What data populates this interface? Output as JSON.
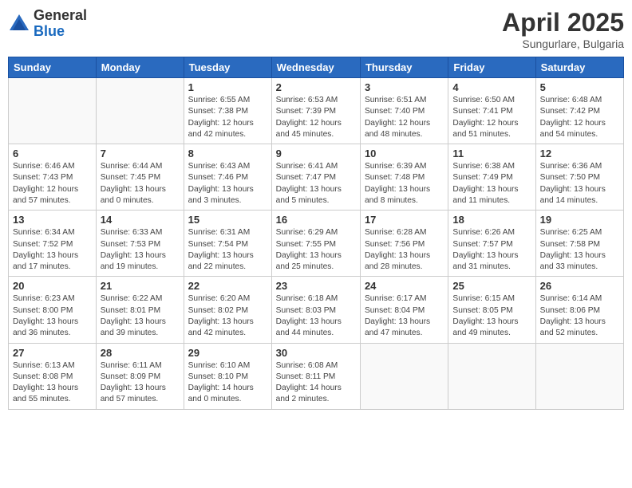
{
  "header": {
    "logo_general": "General",
    "logo_blue": "Blue",
    "month_year": "April 2025",
    "location": "Sungurlare, Bulgaria"
  },
  "days_of_week": [
    "Sunday",
    "Monday",
    "Tuesday",
    "Wednesday",
    "Thursday",
    "Friday",
    "Saturday"
  ],
  "weeks": [
    [
      {
        "day": "",
        "info": ""
      },
      {
        "day": "",
        "info": ""
      },
      {
        "day": "1",
        "info": "Sunrise: 6:55 AM\nSunset: 7:38 PM\nDaylight: 12 hours\nand 42 minutes."
      },
      {
        "day": "2",
        "info": "Sunrise: 6:53 AM\nSunset: 7:39 PM\nDaylight: 12 hours\nand 45 minutes."
      },
      {
        "day": "3",
        "info": "Sunrise: 6:51 AM\nSunset: 7:40 PM\nDaylight: 12 hours\nand 48 minutes."
      },
      {
        "day": "4",
        "info": "Sunrise: 6:50 AM\nSunset: 7:41 PM\nDaylight: 12 hours\nand 51 minutes."
      },
      {
        "day": "5",
        "info": "Sunrise: 6:48 AM\nSunset: 7:42 PM\nDaylight: 12 hours\nand 54 minutes."
      }
    ],
    [
      {
        "day": "6",
        "info": "Sunrise: 6:46 AM\nSunset: 7:43 PM\nDaylight: 12 hours\nand 57 minutes."
      },
      {
        "day": "7",
        "info": "Sunrise: 6:44 AM\nSunset: 7:45 PM\nDaylight: 13 hours\nand 0 minutes."
      },
      {
        "day": "8",
        "info": "Sunrise: 6:43 AM\nSunset: 7:46 PM\nDaylight: 13 hours\nand 3 minutes."
      },
      {
        "day": "9",
        "info": "Sunrise: 6:41 AM\nSunset: 7:47 PM\nDaylight: 13 hours\nand 5 minutes."
      },
      {
        "day": "10",
        "info": "Sunrise: 6:39 AM\nSunset: 7:48 PM\nDaylight: 13 hours\nand 8 minutes."
      },
      {
        "day": "11",
        "info": "Sunrise: 6:38 AM\nSunset: 7:49 PM\nDaylight: 13 hours\nand 11 minutes."
      },
      {
        "day": "12",
        "info": "Sunrise: 6:36 AM\nSunset: 7:50 PM\nDaylight: 13 hours\nand 14 minutes."
      }
    ],
    [
      {
        "day": "13",
        "info": "Sunrise: 6:34 AM\nSunset: 7:52 PM\nDaylight: 13 hours\nand 17 minutes."
      },
      {
        "day": "14",
        "info": "Sunrise: 6:33 AM\nSunset: 7:53 PM\nDaylight: 13 hours\nand 19 minutes."
      },
      {
        "day": "15",
        "info": "Sunrise: 6:31 AM\nSunset: 7:54 PM\nDaylight: 13 hours\nand 22 minutes."
      },
      {
        "day": "16",
        "info": "Sunrise: 6:29 AM\nSunset: 7:55 PM\nDaylight: 13 hours\nand 25 minutes."
      },
      {
        "day": "17",
        "info": "Sunrise: 6:28 AM\nSunset: 7:56 PM\nDaylight: 13 hours\nand 28 minutes."
      },
      {
        "day": "18",
        "info": "Sunrise: 6:26 AM\nSunset: 7:57 PM\nDaylight: 13 hours\nand 31 minutes."
      },
      {
        "day": "19",
        "info": "Sunrise: 6:25 AM\nSunset: 7:58 PM\nDaylight: 13 hours\nand 33 minutes."
      }
    ],
    [
      {
        "day": "20",
        "info": "Sunrise: 6:23 AM\nSunset: 8:00 PM\nDaylight: 13 hours\nand 36 minutes."
      },
      {
        "day": "21",
        "info": "Sunrise: 6:22 AM\nSunset: 8:01 PM\nDaylight: 13 hours\nand 39 minutes."
      },
      {
        "day": "22",
        "info": "Sunrise: 6:20 AM\nSunset: 8:02 PM\nDaylight: 13 hours\nand 42 minutes."
      },
      {
        "day": "23",
        "info": "Sunrise: 6:18 AM\nSunset: 8:03 PM\nDaylight: 13 hours\nand 44 minutes."
      },
      {
        "day": "24",
        "info": "Sunrise: 6:17 AM\nSunset: 8:04 PM\nDaylight: 13 hours\nand 47 minutes."
      },
      {
        "day": "25",
        "info": "Sunrise: 6:15 AM\nSunset: 8:05 PM\nDaylight: 13 hours\nand 49 minutes."
      },
      {
        "day": "26",
        "info": "Sunrise: 6:14 AM\nSunset: 8:06 PM\nDaylight: 13 hours\nand 52 minutes."
      }
    ],
    [
      {
        "day": "27",
        "info": "Sunrise: 6:13 AM\nSunset: 8:08 PM\nDaylight: 13 hours\nand 55 minutes."
      },
      {
        "day": "28",
        "info": "Sunrise: 6:11 AM\nSunset: 8:09 PM\nDaylight: 13 hours\nand 57 minutes."
      },
      {
        "day": "29",
        "info": "Sunrise: 6:10 AM\nSunset: 8:10 PM\nDaylight: 14 hours\nand 0 minutes."
      },
      {
        "day": "30",
        "info": "Sunrise: 6:08 AM\nSunset: 8:11 PM\nDaylight: 14 hours\nand 2 minutes."
      },
      {
        "day": "",
        "info": ""
      },
      {
        "day": "",
        "info": ""
      },
      {
        "day": "",
        "info": ""
      }
    ]
  ]
}
